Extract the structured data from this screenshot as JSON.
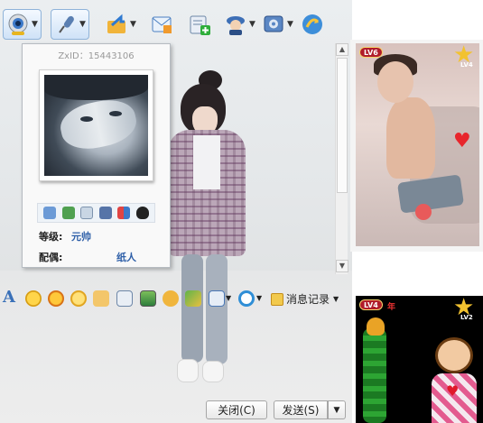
{
  "toolbar": {
    "items": [
      {
        "icon": "webcam-icon",
        "has_menu": true,
        "active": true
      },
      {
        "icon": "microphone-icon",
        "has_menu": true,
        "active": true
      },
      {
        "icon": "send-file-icon",
        "has_menu": true
      },
      {
        "icon": "message-card-icon",
        "has_menu": false
      },
      {
        "icon": "add-apps-icon",
        "has_menu": false
      },
      {
        "icon": "remote-assist-icon",
        "has_menu": true
      },
      {
        "icon": "settings-icon",
        "has_menu": true
      },
      {
        "icon": "share-screen-icon",
        "has_menu": false
      }
    ]
  },
  "card": {
    "zxid": "ZxID：15443106",
    "level_label": "等级:",
    "level_value": "元帅",
    "spouse_label": "配偶:",
    "spouse_value": "纸人",
    "icons": [
      "mail-icon",
      "add-friend-icon",
      "search-doc-icon",
      "profile-card-icon",
      "game-blocks-icon",
      "penguin-icon"
    ]
  },
  "format_bar": {
    "font_label": "A",
    "history_label": "消息记录",
    "icons": [
      "emoji-smile-icon",
      "emoji-sticker-icon",
      "emoji-face-icon",
      "hand-icon",
      "edit-pen-icon",
      "image-icon",
      "music-icon",
      "scene-icon",
      "screenshot-icon",
      "search-s-icon"
    ]
  },
  "buttons": {
    "close": "关闭(C)",
    "send": "发送(S)",
    "send_dropdown": "▼"
  },
  "show_panels": {
    "top_level_badge": "LV6",
    "top_star_level": "LV4",
    "bottom_level_badge": "LV4",
    "bottom_tag": "年",
    "bottom_star_level": "LV2"
  },
  "colors": {
    "link_blue": "#2e5fa8",
    "badge_red": "#b01c2a",
    "star_gold": "#f2c230"
  }
}
